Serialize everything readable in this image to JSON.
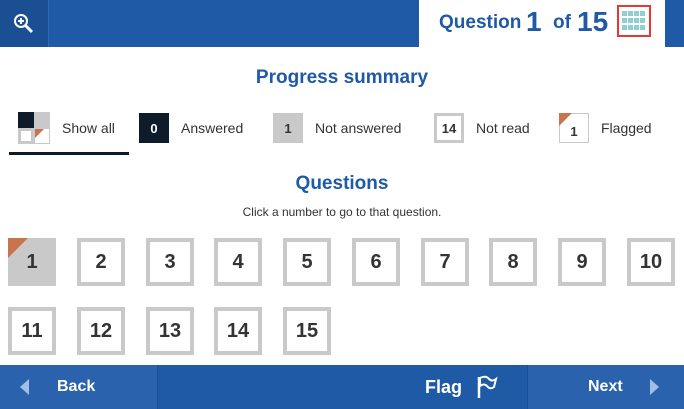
{
  "header": {
    "question_word": "Question",
    "current": "1",
    "of_word": "of",
    "total": "15"
  },
  "progress": {
    "title": "Progress summary",
    "legend": {
      "show_all": "Show all",
      "answered_count": "0",
      "answered": "Answered",
      "not_answered_count": "1",
      "not_answered": "Not answered",
      "not_read_count": "14",
      "not_read": "Not read",
      "flagged_count": "1",
      "flagged": "Flagged"
    }
  },
  "questions": {
    "title": "Questions",
    "instruction": "Click a number to go to that question.",
    "items": [
      "1",
      "2",
      "3",
      "4",
      "5",
      "6",
      "7",
      "8",
      "9",
      "10",
      "11",
      "12",
      "13",
      "14",
      "15"
    ]
  },
  "footer": {
    "back": "Back",
    "flag": "Flag",
    "next": "Next"
  },
  "colors": {
    "primary": "#1f5aa6",
    "flag": "#c8744f",
    "highlight": "#e53935"
  }
}
